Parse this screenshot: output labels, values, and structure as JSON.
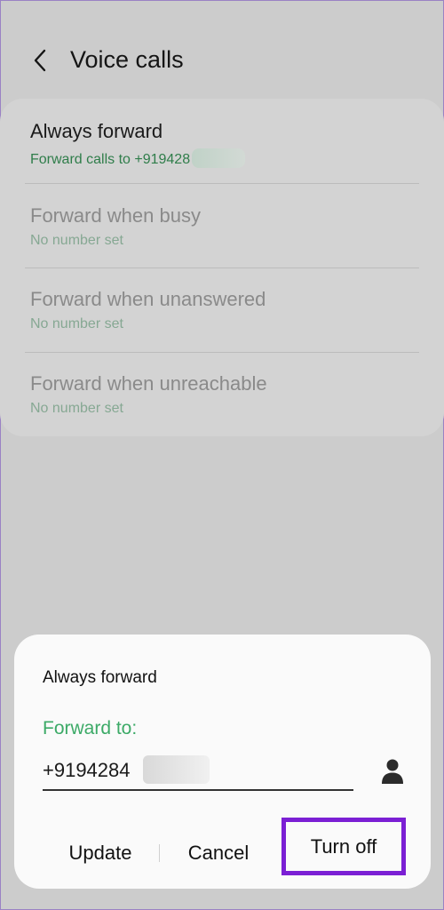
{
  "header": {
    "title": "Voice calls",
    "back_icon": "chevron-left-icon"
  },
  "forward_list": {
    "items": [
      {
        "title": "Always forward",
        "subtitle": "Forward calls to +919428",
        "enabled": true
      },
      {
        "title": "Forward when busy",
        "subtitle": "No number set",
        "enabled": false
      },
      {
        "title": "Forward when unanswered",
        "subtitle": "No number set",
        "enabled": false
      },
      {
        "title": "Forward when unreachable",
        "subtitle": "No number set",
        "enabled": false
      }
    ]
  },
  "dialog": {
    "title": "Always forward",
    "forward_label": "Forward to:",
    "number_value": "+9194284",
    "contact_icon": "person-icon",
    "buttons": {
      "update": "Update",
      "cancel": "Cancel",
      "turn_off": "Turn off"
    }
  },
  "colors": {
    "accent_green": "#3caa67",
    "subtitle_green": "#2f7d4a",
    "highlight_purple": "#7b1fd4",
    "scrim": "#cccccc"
  }
}
